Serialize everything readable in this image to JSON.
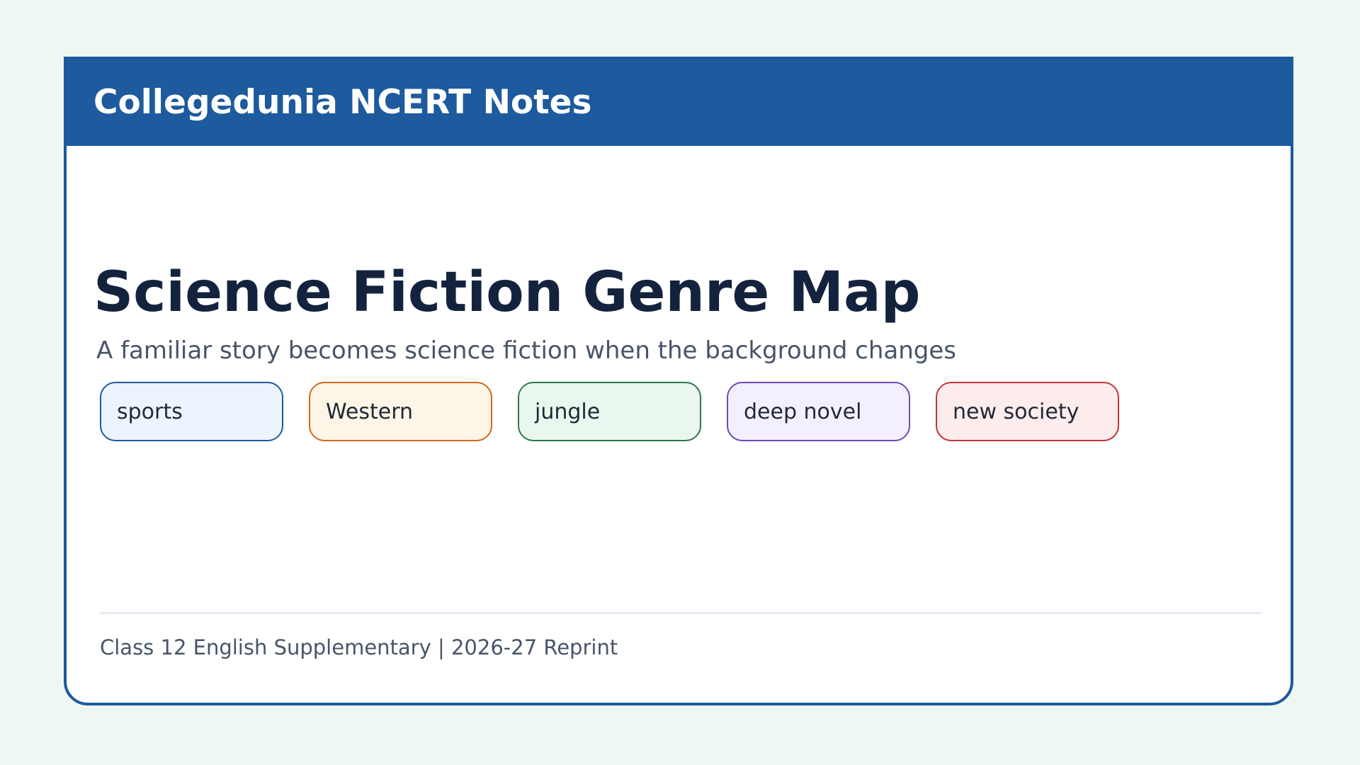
{
  "header": {
    "brand": "Collegedunia NCERT Notes"
  },
  "main": {
    "title": "Science Fiction Genre Map",
    "subtitle": "A familiar story becomes science fiction when the background changes",
    "tags": [
      {
        "label": "sports",
        "fill": "#eef4fe",
        "stroke": "#1d5a9e"
      },
      {
        "label": "Western",
        "fill": "#fdf5e6",
        "stroke": "#d2691e"
      },
      {
        "label": "jungle",
        "fill": "#e9f7ee",
        "stroke": "#2a7a4b"
      },
      {
        "label": "deep novel",
        "fill": "#f4effe",
        "stroke": "#6b4bb3"
      },
      {
        "label": "new society",
        "fill": "#fdecec",
        "stroke": "#c0343a"
      }
    ]
  },
  "footer": {
    "text": "Class 12 English Supplementary | 2026-27 Reprint"
  },
  "colors": {
    "accent": "#1d5a9e",
    "background": "#eef7f2",
    "title": "#14233d",
    "muted": "#475569"
  }
}
